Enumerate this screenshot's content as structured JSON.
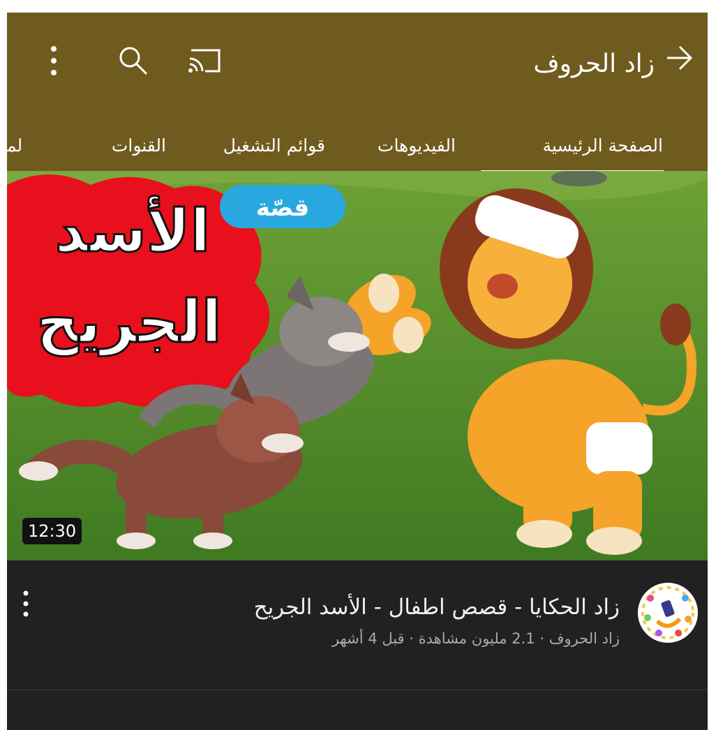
{
  "header": {
    "title": "زاد الحروف",
    "back_icon": "arrow-right-icon",
    "actions": [
      "cast-icon",
      "search-icon",
      "more-vert-icon"
    ],
    "background": "#6f5b1e"
  },
  "tabs": [
    {
      "label": "الصفحة الرئيسية",
      "active": true
    },
    {
      "label": "الفيديوهات",
      "active": false
    },
    {
      "label": "قوائم التشغيل",
      "active": false
    },
    {
      "label": "القنوات",
      "active": false
    },
    {
      "label": "لمح",
      "active": false
    }
  ],
  "video": {
    "thumbnail_title_line1": "الأسد",
    "thumbnail_title_line2": "الجريح",
    "thumbnail_badge": "قصّة",
    "duration": "12:30",
    "title": "زاد الحكايا - قصص اطفال - الأسد الجريح",
    "subtitle": "زاد الحروف · 2.1 مليون مشاهدة · قبل 4 أشهر"
  },
  "colors": {
    "accent": "#6f5b1e",
    "dark_bg": "#212121",
    "badge": "#29a8e0",
    "cloud": "#e8101c"
  }
}
